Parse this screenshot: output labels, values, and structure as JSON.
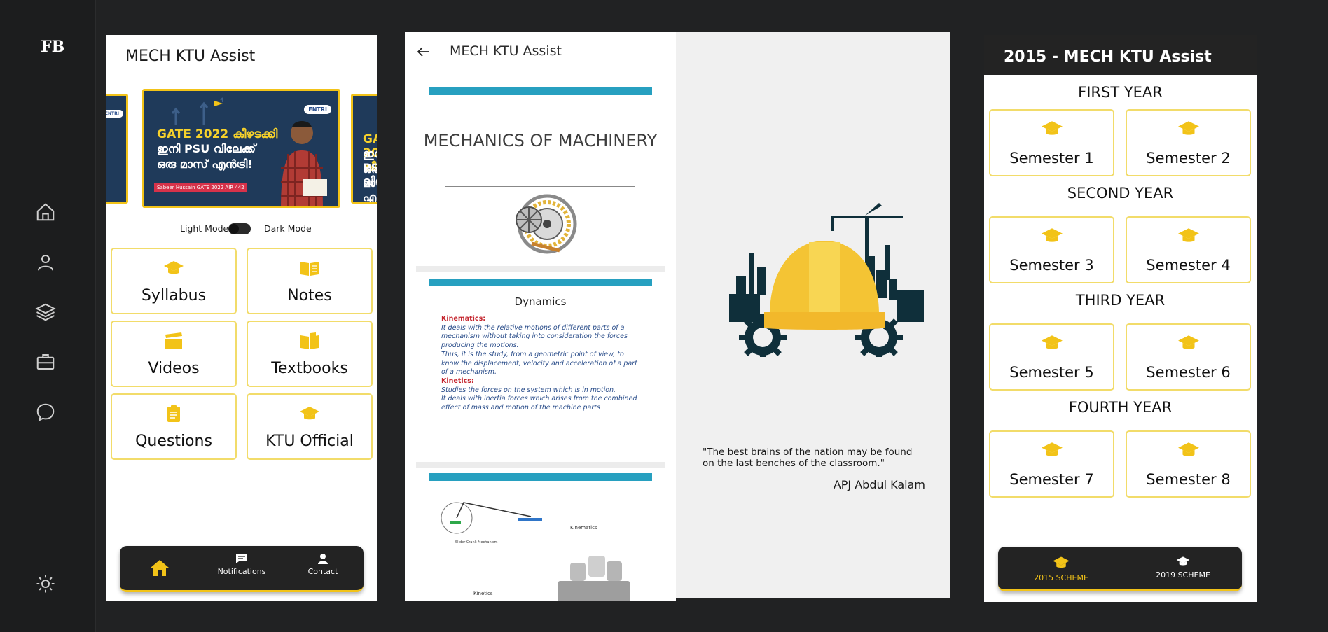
{
  "colors": {
    "accent": "#f2c318",
    "dark": "#232323",
    "tile_border": "#f2dc6a"
  },
  "rail": {
    "logo": "FB",
    "icons": [
      "home-icon",
      "user-icon",
      "layers-icon",
      "briefcase-icon",
      "chat-icon",
      "sun-icon"
    ]
  },
  "home": {
    "app_title": "MECH KTU Assist",
    "banner": {
      "badge": "ENTRI",
      "line1": "GATE 2022 കീഴടക്കി",
      "line2": "ഇനി PSU വിലേക്ക്",
      "line3": "ഒരു മാസ് എൻട്രി!",
      "strip": "Sabeer Hussain GATE 2022 AIR 442"
    },
    "light_mode_label": "Light Mode",
    "dark_mode_label": "Dark Mode",
    "tiles": [
      {
        "label": "Syllabus",
        "icon": "graduation-cap-icon"
      },
      {
        "label": "Notes",
        "icon": "open-book-icon"
      },
      {
        "label": "Videos",
        "icon": "clapperboard-icon"
      },
      {
        "label": "Textbooks",
        "icon": "book-icon"
      },
      {
        "label": "Questions",
        "icon": "clipboard-icon"
      },
      {
        "label": "KTU Official",
        "icon": "graduation-cap-icon"
      }
    ],
    "nav": {
      "home": "",
      "notifications": "Notifications",
      "contact": "Contact"
    }
  },
  "pdf": {
    "title": "MECH KTU Assist",
    "page1_title": "MECHANICS OF MACHINERY",
    "page2_title": "Dynamics",
    "page2_kinematics_head": "Kinematics:",
    "page2_kinematics_1": "It deals with the relative motions of different parts of a mechanism without taking into consideration the forces producing the motions.",
    "page2_kinematics_2": "Thus, it is the study, from a geometric point of view, to know the displacement, velocity and acceleration of a part of a mechanism.",
    "page2_kinetics_head": "Kinetics:",
    "page2_kinetics_1": "Studies the forces on the system which is in motion.",
    "page2_kinetics_2": "It deals with inertia forces which arises from the combined effect of mass and motion of the machine parts",
    "page3_label_kinematics": "Kinematics",
    "page3_label_mechanism": "Slider Crank Mechanism",
    "page3_label_kinetics": "Kinetics"
  },
  "splash": {
    "quote": "\"The best brains of the nation may be found on the last benches of the classroom.\"",
    "author": "APJ Abdul Kalam"
  },
  "semesters": {
    "title": "2015 - MECH KTU Assist",
    "years": [
      "FIRST YEAR",
      "SECOND YEAR",
      "THIRD YEAR",
      "FOURTH YEAR"
    ],
    "semesters": [
      "Semester 1",
      "Semester 2",
      "Semester 3",
      "Semester 4",
      "Semester 5",
      "Semester 6",
      "Semester 7",
      "Semester 8"
    ],
    "nav_2015": "2015 SCHEME",
    "nav_2019": "2019 SCHEME"
  }
}
